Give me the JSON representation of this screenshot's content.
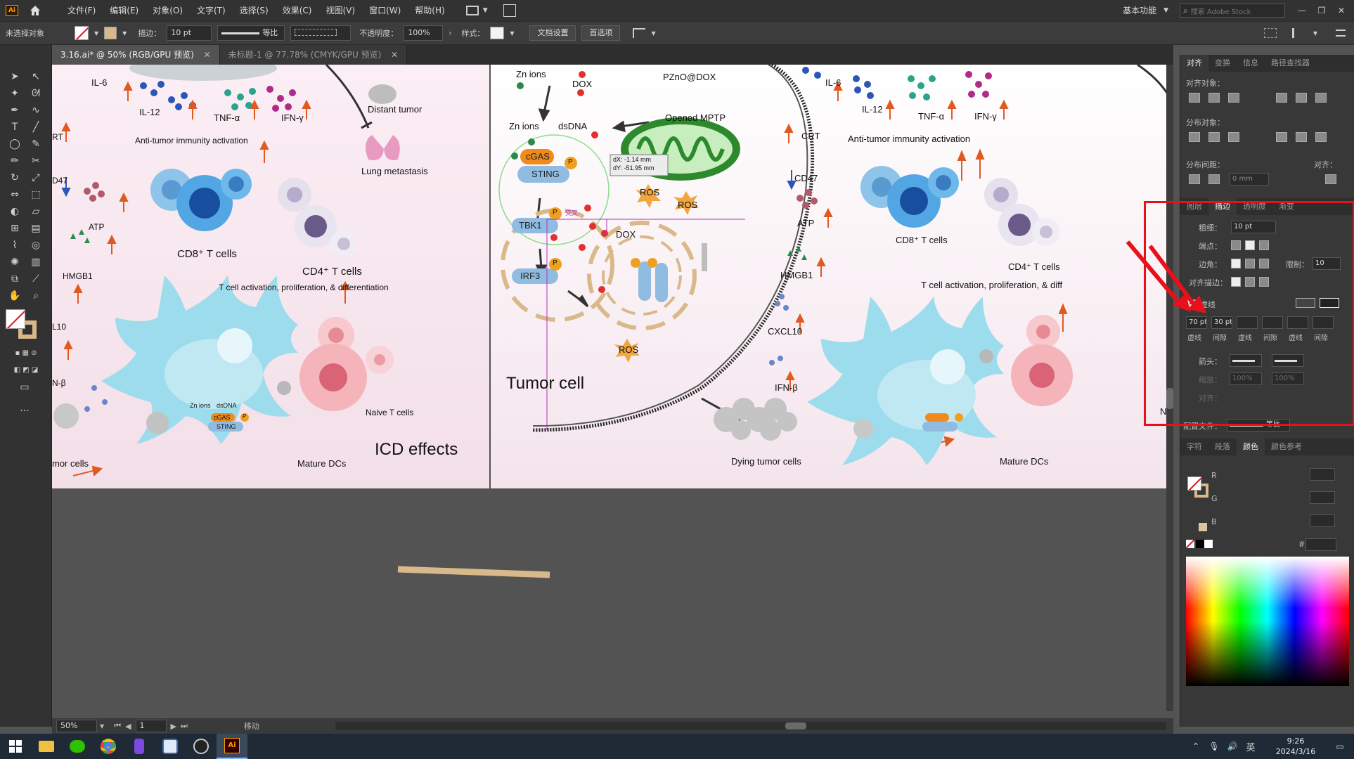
{
  "menubar": {
    "logo": "Ai",
    "items": [
      "文件(F)",
      "编辑(E)",
      "对象(O)",
      "文字(T)",
      "选择(S)",
      "效果(C)",
      "视图(V)",
      "窗口(W)",
      "帮助(H)"
    ],
    "workspace": "基本功能",
    "search_placeholder": "搜索 Adobe Stock"
  },
  "control": {
    "no_selection": "未选择对象",
    "stroke_label": "描边：",
    "stroke_value": "10 pt",
    "profile": "等比",
    "opacity_label": "不透明度：",
    "opacity_value": "100%",
    "style_label": "样式：",
    "doc_setup": "文档设置",
    "preferences": "首选项"
  },
  "tabs": [
    {
      "label": "3.16.ai* @ 50% (RGB/GPU 预览)"
    },
    {
      "label": "未标题-1 @ 77.78% (CMYK/GPU 预览)"
    }
  ],
  "artboard1": {
    "il6": "IL-6",
    "il12": "IL-12",
    "tnf": "TNF-α",
    "ifn": "IFN-γ",
    "distant": "Distant tumor",
    "lung": "Lung metastasis",
    "antitumor": "Anti-tumor immunity activation",
    "crt": "RT",
    "cd47": "D47",
    "atp": "ATP",
    "hmgb1": "HMGB1",
    "cd8": "CD8⁺ T cells",
    "cd4": "CD4⁺ T cells",
    "tcell": "T cell activation, proliferation, & differentiation",
    "cxcl": "L10",
    "ifnb": "N-β",
    "zn": "Zn ions",
    "dsdna": "dsDNA",
    "cgas": "cGAS",
    "sting": "STING",
    "p": "P",
    "naive": "Naive T cells",
    "icd": "ICD effects",
    "mature": "Mature DCs",
    "tumorcells": "mor cells"
  },
  "artboard2": {
    "zn_top": "Zn ions",
    "dox_top": "DOX",
    "pzno": "PZnO@DOX",
    "zn_mid": "Zn ions",
    "dsdna": "dsDNA",
    "mptp": "Opened MPTP",
    "cgas": "cGAS",
    "sting": "STING",
    "p": "P",
    "tbk1": "TBK1",
    "irf3": "IRF3",
    "ros": "ROS",
    "dox": "DOX",
    "tumor": "Tumor cell",
    "tooltip1": "dX: -1.14 mm",
    "tooltip2": "dY: -51.95 mm",
    "intersect": "交叉",
    "crt": "CRT",
    "cd47": "CD47",
    "atp": "ATP",
    "hmgb1": "HMGB1",
    "cxcl10": "CXCL10",
    "ifnb": "IFN-β",
    "il6": "IL-6",
    "il12": "IL-12",
    "tnf": "TNF-α",
    "ifng": "IFN-γ",
    "antitumor": "Anti-tumor immunity activation",
    "cd8": "CD8⁺ T cells",
    "cd4": "CD4⁺ T cells",
    "tcell": "T cell activation, proliferation, & diff",
    "na": "Na",
    "dying": "Dying tumor cells",
    "mature": "Mature DCs"
  },
  "status": {
    "zoom": "50%",
    "page": "1",
    "tool": "移动"
  },
  "panel": {
    "top_tabs": [
      "对齐",
      "变换",
      "信息",
      "路径查找器"
    ],
    "align_objects": "对齐对象：",
    "distribute_objects": "分布对象：",
    "distribute_spacing": "分布间距：",
    "align_to": "对齐：",
    "spacing_value": "0 mm",
    "stroke_tabs": [
      "图层",
      "描边",
      "透明度",
      "渐变"
    ],
    "weight_label": "粗细：",
    "weight_value": "10 pt",
    "cap_label": "端点：",
    "corner_label": "边角：",
    "limit_label": "限制：",
    "limit_value": "10",
    "align_stroke_label": "对齐描边：",
    "dashed_label": "虚线",
    "dash_values": [
      "70 pt",
      "30 pt",
      "",
      "",
      "",
      ""
    ],
    "dash_labels": [
      "虚线",
      "间隙",
      "虚线",
      "间隙",
      "虚线",
      "间隙"
    ],
    "arrow_label": "箭头：",
    "scale_label": "缩放：",
    "scale_value": "100%",
    "align_label": "对齐：",
    "profile_label": "配置文件：",
    "profile_value": "等比",
    "color_tabs": [
      "字符",
      "段落",
      "颜色",
      "颜色参考"
    ],
    "r_label": "R",
    "g_label": "G",
    "b_label": "B",
    "hex_label": "#"
  },
  "taskbar": {
    "time": "9:26",
    "date": "2024/3/16",
    "ime": "英"
  },
  "colors": {
    "highlight": "#e8101a",
    "ui_bg": "#535353",
    "panel": "#383838",
    "menu": "#323232"
  }
}
